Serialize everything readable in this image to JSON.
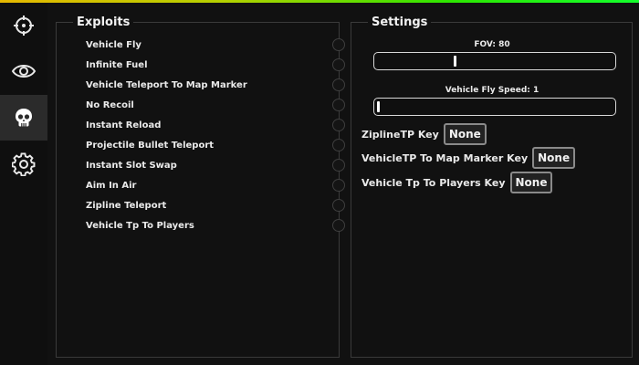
{
  "accent_gradient": [
    "#e6b800",
    "#2ee600",
    "#13ff2c"
  ],
  "sidebar": {
    "items": [
      {
        "icon": "crosshair-icon"
      },
      {
        "icon": "eye-icon"
      },
      {
        "icon": "skull-icon",
        "active": true
      },
      {
        "icon": "gear-icon"
      }
    ]
  },
  "exploits": {
    "title": "Exploits",
    "items": [
      {
        "label": "Vehicle Fly"
      },
      {
        "label": "Infinite Fuel"
      },
      {
        "label": "Vehicle Teleport To Map Marker"
      },
      {
        "label": "No Recoil"
      },
      {
        "label": "Instant Reload"
      },
      {
        "label": "Projectile Bullet Teleport"
      },
      {
        "label": "Instant Slot Swap"
      },
      {
        "label": "Aim In Air"
      },
      {
        "label": "Zipline Teleport"
      },
      {
        "label": "Vehicle Tp To Players"
      }
    ]
  },
  "settings": {
    "title": "Settings",
    "fov": {
      "label": "FOV: 80",
      "fraction": 0.33
    },
    "fly_speed": {
      "label": "Vehicle Fly Speed: 1",
      "fraction": 0.0
    },
    "keys": [
      {
        "label": "ZiplineTP Key",
        "value": "None"
      },
      {
        "label": "VehicleTP To Map Marker Key",
        "value": "None"
      },
      {
        "label": "Vehicle Tp To Players Key",
        "value": "None"
      }
    ]
  }
}
